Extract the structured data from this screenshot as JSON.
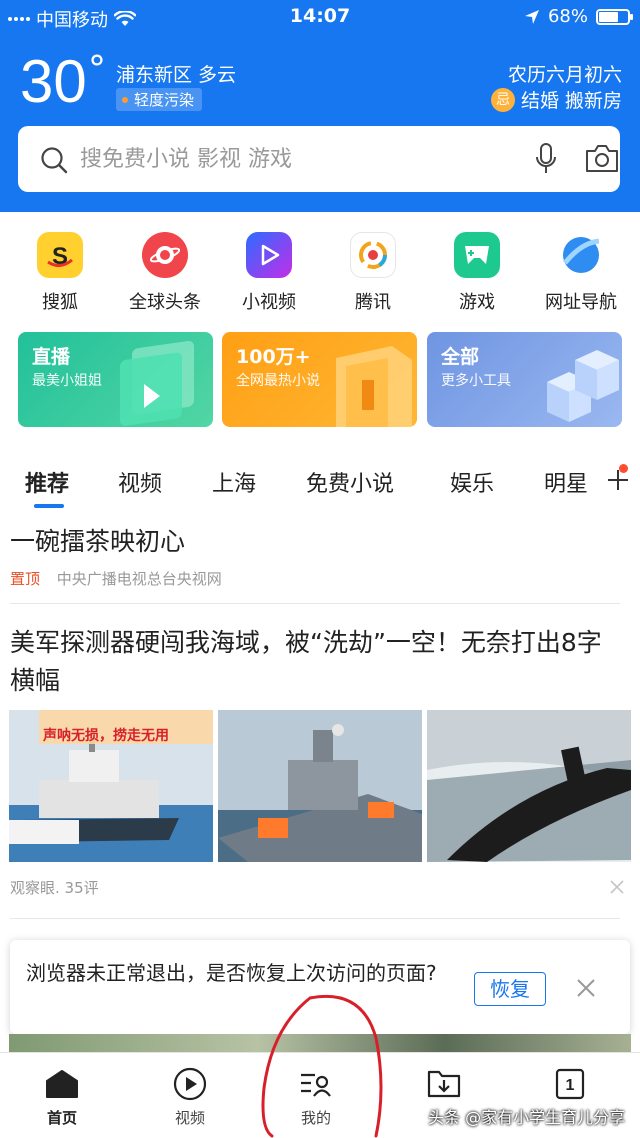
{
  "status_bar": {
    "carrier": "中国移动",
    "time": "14:07",
    "battery_percent": 68,
    "battery_label": "68%"
  },
  "weather": {
    "temperature": "30",
    "degree_symbol": "°",
    "location": "浦东新区 多云",
    "air_quality": "轻度污染",
    "lunar_date": "农历六月初六",
    "almanac_badge": "忌",
    "almanac_text": "结婚 搬新房"
  },
  "search": {
    "placeholder": "搜免费小说 影视 游戏"
  },
  "shortcuts": [
    {
      "label": "搜狐",
      "icon": "sohu-icon"
    },
    {
      "label": "全球头条",
      "icon": "global-headlines-icon"
    },
    {
      "label": "小视频",
      "icon": "short-video-icon"
    },
    {
      "label": "腾讯",
      "icon": "tencent-news-icon"
    },
    {
      "label": "游戏",
      "icon": "game-icon"
    },
    {
      "label": "网址导航",
      "icon": "web-nav-icon"
    }
  ],
  "cards": [
    {
      "title": "直播",
      "subtitle": "最美小姐姐",
      "color": "#27c39b"
    },
    {
      "title": "100万+",
      "subtitle": "全网最热小说",
      "color": "#ffa31a"
    },
    {
      "title": "全部",
      "subtitle": "更多小工具",
      "color": "#7ba0e6"
    }
  ],
  "tabs": [
    "推荐",
    "视频",
    "上海",
    "免费小说",
    "娱乐",
    "明星"
  ],
  "feed": [
    {
      "title": "一碗擂茶映初心",
      "tag": "置顶",
      "source": "中央广播电视总台央视网"
    },
    {
      "title": "美军探测器硬闯我海域，被“洗劫”一空！无奈打出8字横幅",
      "image_caption": "声呐无损，捞走无用",
      "meta": "观察眼. 35评"
    }
  ],
  "restore_prompt": {
    "text": "浏览器未正常退出，是否恢复上次访问的页面?",
    "button": "恢复"
  },
  "bottom_nav": [
    {
      "label": "首页",
      "icon": "home-icon"
    },
    {
      "label": "视频",
      "icon": "video-play-icon"
    },
    {
      "label": "我的",
      "icon": "profile-icon"
    },
    {
      "label": "",
      "icon": "download-icon"
    },
    {
      "label": "",
      "icon": "tabs-count-icon",
      "count": "1"
    }
  ],
  "watermark": "头条 @家有小学生育儿分享",
  "colors": {
    "brand_blue": "#1677f0",
    "tag_red": "#e8502a",
    "annotation_red": "#d8202a"
  }
}
